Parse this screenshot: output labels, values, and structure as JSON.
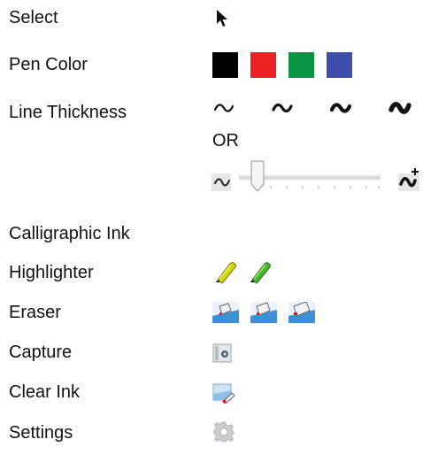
{
  "tools": {
    "select": {
      "label": "Select",
      "icon": "cursor-arrow-icon"
    },
    "pen_color": {
      "label": "Pen Color",
      "colors": [
        {
          "name": "black",
          "hex": "#000000"
        },
        {
          "name": "red",
          "hex": "#ee2124"
        },
        {
          "name": "green",
          "hex": "#0a9444"
        },
        {
          "name": "blue",
          "hex": "#3c4ea8"
        }
      ]
    },
    "line_thickness": {
      "label": "Line Thickness",
      "separator": "OR",
      "presets": [
        "thin-stroke-icon",
        "medium-stroke-icon",
        "thick-stroke-icon",
        "extra-thick-stroke-icon"
      ],
      "slider": {
        "min_icon": "thin-line-icon",
        "max_icon": "thick-line-plus-icon",
        "value": 0
      }
    },
    "calligraphic_ink": {
      "label": "Calligraphic Ink"
    },
    "highlighter": {
      "label": "Highlighter",
      "icons": [
        "yellow-highlighter-icon",
        "green-highlighter-icon"
      ]
    },
    "eraser": {
      "label": "Eraser",
      "icons": [
        "eraser-small-icon",
        "eraser-medium-icon",
        "eraser-large-icon"
      ]
    },
    "capture": {
      "label": "Capture",
      "icon": "camera-icon"
    },
    "clear_ink": {
      "label": "Clear Ink",
      "icon": "clear-ink-icon"
    },
    "settings": {
      "label": "Settings",
      "icon": "gear-icon"
    }
  }
}
